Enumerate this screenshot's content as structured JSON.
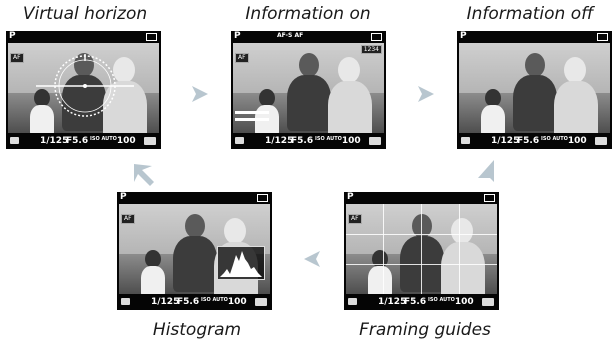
{
  "captions": {
    "virtual_horizon": "Virtual horizon",
    "information_on": "Information on",
    "information_off": "Information off",
    "histogram": "Histogram",
    "framing_guides": "Framing guides"
  },
  "screen": {
    "mode": "P",
    "af_label": "AF",
    "shutter": "1/125",
    "aperture": "F5.6",
    "iso_label": "ISO AUTO",
    "iso": "100"
  },
  "info_on": {
    "top_row": "AF-S  AF",
    "time": "1234"
  }
}
